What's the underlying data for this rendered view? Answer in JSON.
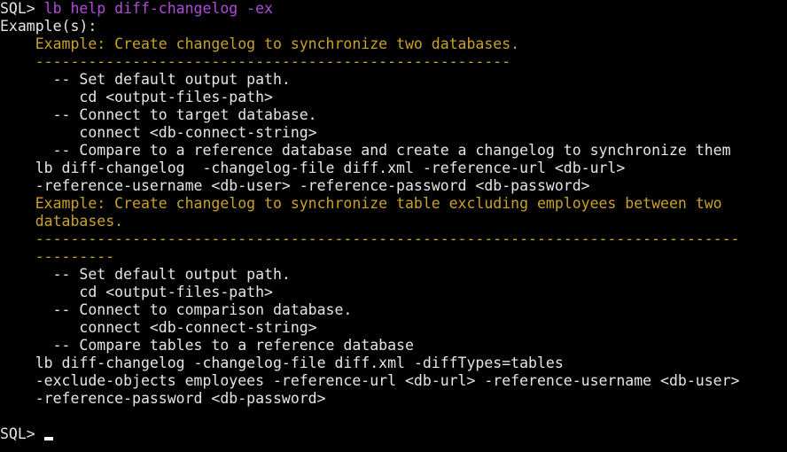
{
  "terminal": {
    "prompt": "SQL> ",
    "command": "lb help diff-changelog -ex",
    "examples_header": "Example(s):",
    "example1": {
      "title": "    Example: Create changelog to synchronize two databases.",
      "rule": "    ------------------------------------------------------",
      "lines": [
        "      -- Set default output path.",
        "         cd <output-files-path>",
        "      -- Connect to target database.",
        "         connect <db-connect-string>",
        "      -- Compare to a reference database and create a changelog to synchronize them",
        "    lb diff-changelog  -changelog-file diff.xml -reference-url <db-url>",
        "    -reference-username <db-user> -reference-password <db-password>"
      ]
    },
    "example2": {
      "title": "    Example: Create changelog to synchronize table excluding employees between two",
      "title_cont": "    databases.",
      "rule": "    --------------------------------------------------------------------------------",
      "rule_cont": "    ---------",
      "lines": [
        "      -- Set default output path.",
        "         cd <output-files-path>",
        "      -- Connect to comparison database.",
        "         connect <db-connect-string>",
        "      -- Compare tables to a reference database",
        "    lb diff-changelog -changelog-file diff.xml -diffTypes=tables",
        "    -exclude-objects employees -reference-url <db-url> -reference-username <db-user>",
        "    -reference-password <db-password>"
      ]
    },
    "final_prompt": "SQL> "
  }
}
